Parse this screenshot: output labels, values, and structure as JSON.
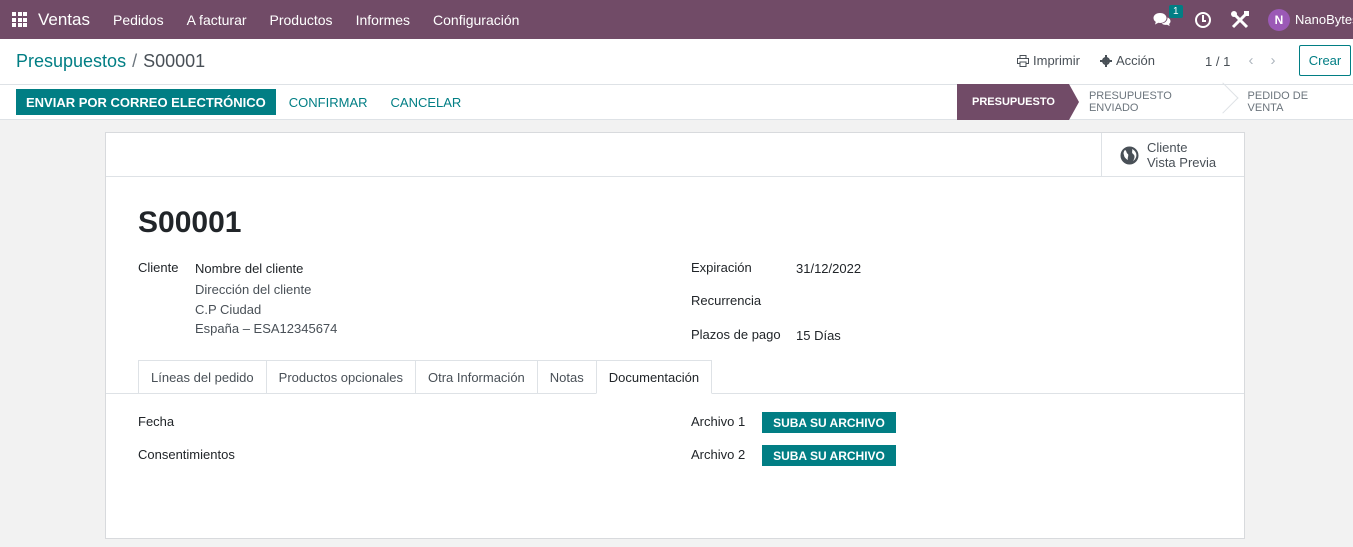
{
  "navbar": {
    "app_name": "Ventas",
    "menu": [
      "Pedidos",
      "A facturar",
      "Productos",
      "Informes",
      "Configuración"
    ],
    "chat_badge": "1",
    "user_initial": "N",
    "user_name": "NanoBytes",
    "color": "#714b67"
  },
  "control_panel": {
    "breadcrumb_parent": "Presupuestos",
    "breadcrumb_sep": "/",
    "breadcrumb_current": "S00001",
    "print_label": "Imprimir",
    "action_label": "Acción",
    "pager": "1 / 1",
    "create_label": "Crear"
  },
  "statusbar": {
    "send_email": "ENVIAR POR CORREO ELECTRÓNICO",
    "confirm": "CONFIRMAR",
    "cancel": "CANCELAR",
    "stages": [
      "PRESUPUESTO",
      "PRESUPUESTO ENVIADO",
      "PEDIDO DE VENTA"
    ],
    "active_stage": "PRESUPUESTO"
  },
  "sheet": {
    "preview_line1": "Cliente",
    "preview_line2": "Vista Previa",
    "title": "S00001",
    "customer_label": "Cliente",
    "customer_name": "Nombre del cliente",
    "customer_address": [
      "Dirección del cliente",
      "C.P Ciudad",
      "España – ESA12345674"
    ],
    "expiration_label": "Expiración",
    "expiration_value": "31/12/2022",
    "recurrence_label": "Recurrencia",
    "payment_terms_label": "Plazos de pago",
    "payment_terms_value": "15 Días",
    "tabs": [
      "Líneas del pedido",
      "Productos opcionales",
      "Otra Información",
      "Notas",
      "Documentación"
    ],
    "active_tab": "Documentación",
    "date_label": "Fecha",
    "consents_label": "Consentimientos",
    "file1_label": "Archivo 1",
    "file2_label": "Archivo 2",
    "upload_label": "SUBA SU ARCHIVO"
  },
  "colors": {
    "accent": "#017e84",
    "brand": "#714b67"
  }
}
